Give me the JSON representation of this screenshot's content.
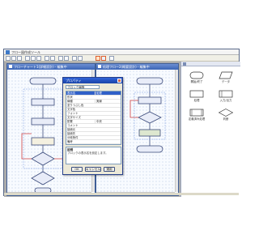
{
  "app": {
    "title": "フロー図作成ツール"
  },
  "windows": [
    {
      "title": "フローチャート1(詳細設計) - 編集中"
    },
    {
      "title": "処理フロー2(概要設計) - 編集中"
    }
  ],
  "dialog": {
    "title": "プロパティ",
    "field_value": "ブロック編集",
    "properties": [
      {
        "key": "表示名",
        "value": "処理"
      },
      {
        "key": "形状",
        "value": ""
      },
      {
        "key": "線種",
        "value": "実線"
      },
      {
        "key": "塗りつぶし色",
        "value": ""
      },
      {
        "key": "文字色",
        "value": ""
      },
      {
        "key": "フォント",
        "value": ""
      },
      {
        "key": "文字サイズ",
        "value": ""
      },
      {
        "key": "配置",
        "value": "中央"
      },
      {
        "key": "コメント",
        "value": ""
      },
      {
        "key": "接続元",
        "value": ""
      },
      {
        "key": "接続先",
        "value": ""
      },
      {
        "key": "分岐条件",
        "value": ""
      },
      {
        "key": "備考",
        "value": ""
      }
    ],
    "description_title": "説明",
    "description_text": "ブロックの表示名を設定します。",
    "ok_label": "OK",
    "cancel_label": "キャンセル",
    "apply_label": "適用"
  },
  "palette": {
    "items": [
      {
        "label": "開始/終了"
      },
      {
        "label": "データ"
      },
      {
        "label": "処理"
      },
      {
        "label": "入力/出力"
      },
      {
        "label": "定義済み処理"
      },
      {
        "label": "判断"
      }
    ]
  },
  "colors": {
    "accent": "#3b65b6",
    "highlight": "#e06030",
    "diagram_fill": "#e8ecf8",
    "diagram_stroke": "#3a4a7a"
  }
}
